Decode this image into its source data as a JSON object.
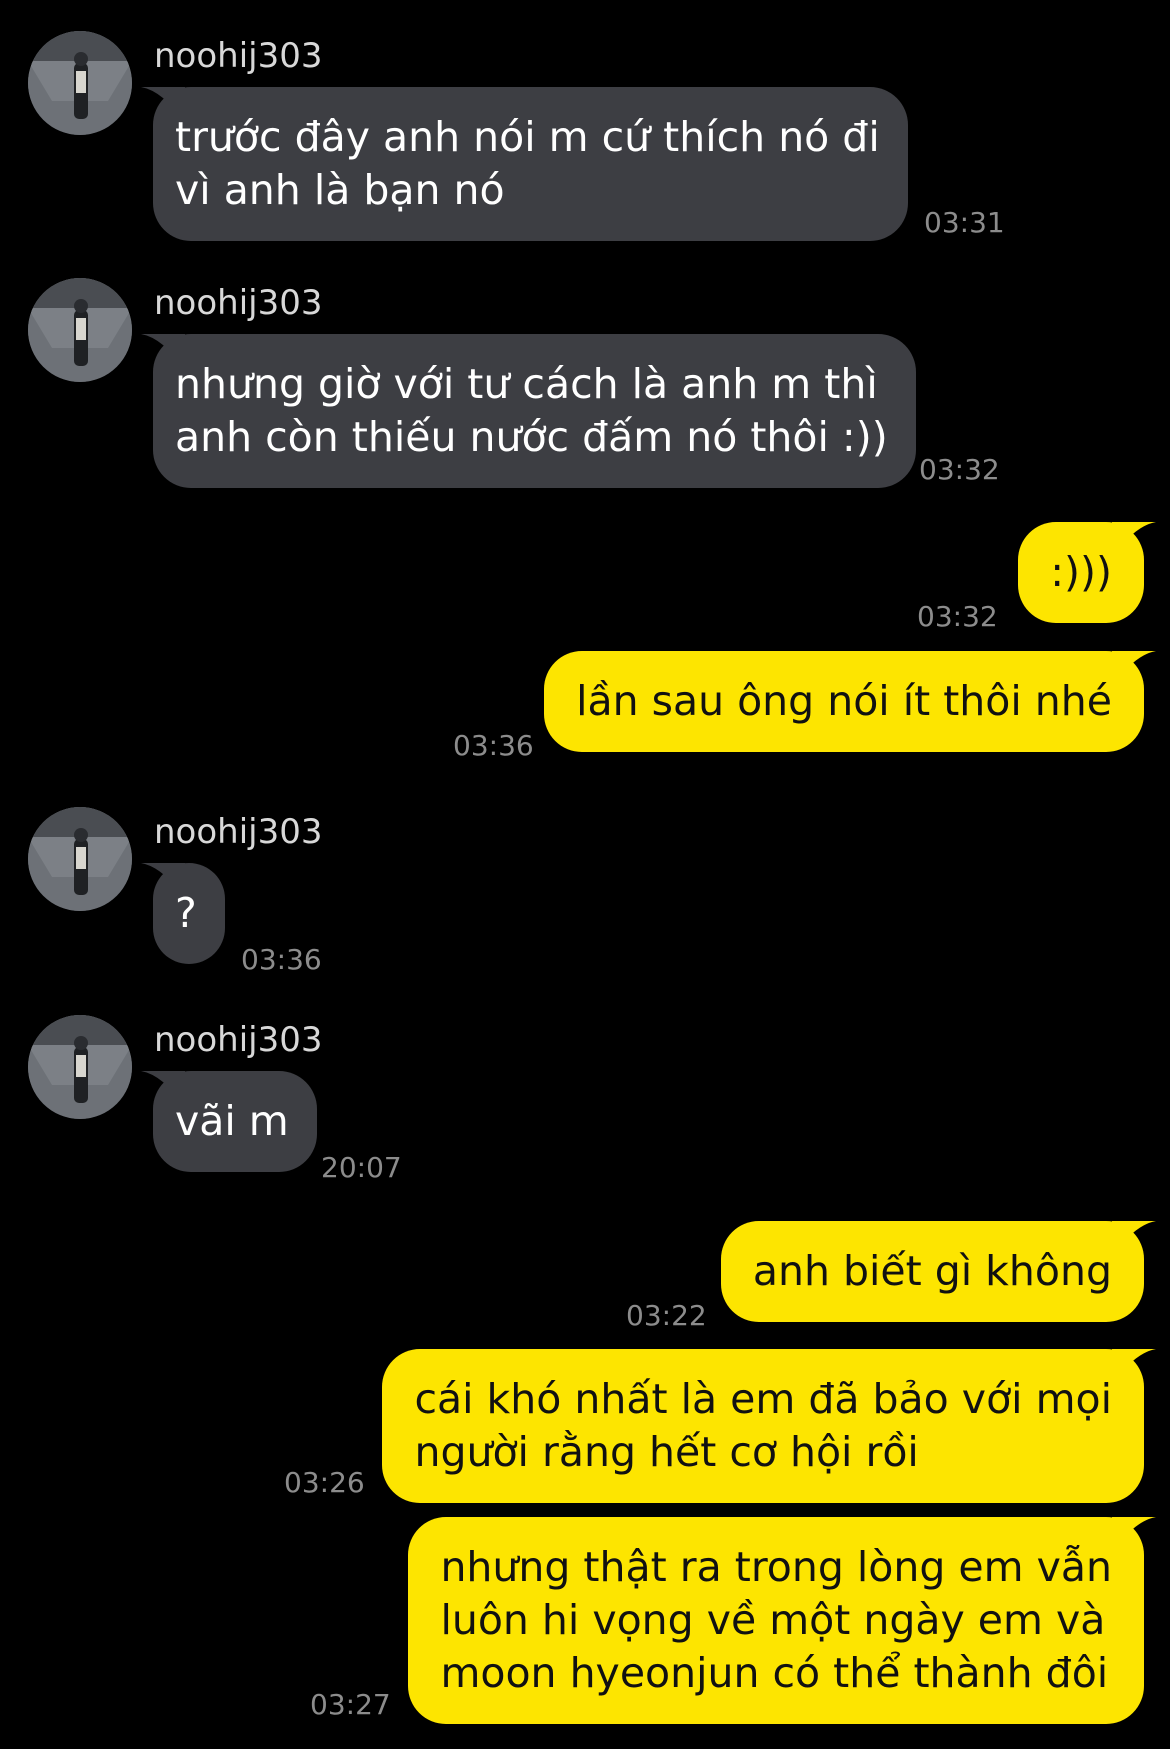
{
  "chat": {
    "colors": {
      "background": "#000000",
      "incoming_bubble": "#3d3e43",
      "outgoing_bubble": "#fde500",
      "timestamp": "#8c8c8c"
    },
    "messages": [
      {
        "direction": "in",
        "sender": "noohij303",
        "lines": [
          "trước đây anh nói m cứ thích nó đi",
          "vì anh là bạn nó"
        ],
        "time": "03:31"
      },
      {
        "direction": "in",
        "sender": "noohij303",
        "lines": [
          "nhưng giờ với tư cách là anh m thì",
          "anh còn thiếu nước đấm nó thôi :))"
        ],
        "time": "03:32"
      },
      {
        "direction": "out",
        "lines": [
          ":)))"
        ],
        "time": "03:32"
      },
      {
        "direction": "out",
        "lines": [
          "lần sau ông nói ít thôi nhé"
        ],
        "time": "03:36"
      },
      {
        "direction": "in",
        "sender": "noohij303",
        "lines": [
          "?"
        ],
        "time": "03:36"
      },
      {
        "direction": "in",
        "sender": "noohij303",
        "lines": [
          "vãi m"
        ],
        "time": "20:07"
      },
      {
        "direction": "out",
        "lines": [
          "anh biết gì không"
        ],
        "time": "03:22"
      },
      {
        "direction": "out",
        "lines": [
          "cái khó nhất là em đã bảo với mọi",
          "người rằng hết cơ hội rồi"
        ],
        "time": "03:26"
      },
      {
        "direction": "out",
        "lines": [
          "nhưng thật ra trong lòng em vẫn",
          "luôn hi vọng về một ngày em và",
          "moon hyeonjun có thể thành đôi"
        ],
        "time": "03:27"
      }
    ]
  }
}
